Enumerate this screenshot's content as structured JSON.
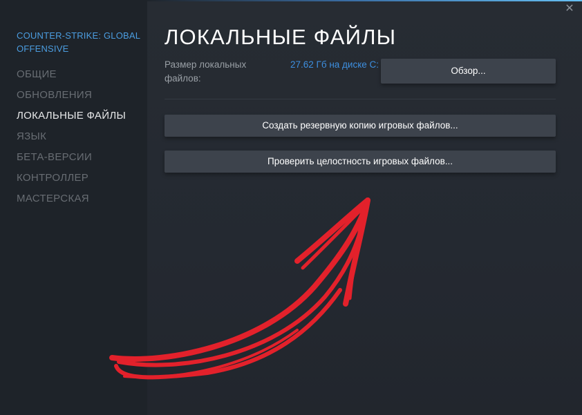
{
  "sidebar": {
    "game_title": "COUNTER-STRIKE: GLOBAL OFFENSIVE",
    "items": [
      {
        "label": "ОБЩИЕ"
      },
      {
        "label": "ОБНОВЛЕНИЯ"
      },
      {
        "label": "ЛОКАЛЬНЫЕ ФАЙЛЫ"
      },
      {
        "label": "ЯЗЫК"
      },
      {
        "label": "БЕТА-ВЕРСИИ"
      },
      {
        "label": "КОНТРОЛЛЕР"
      },
      {
        "label": "МАСТЕРСКАЯ"
      }
    ],
    "active_index": 2
  },
  "window": {
    "close_icon": "close-icon",
    "close_glyph": "✕"
  },
  "main": {
    "title": "ЛОКАЛЬНЫЕ ФАЙЛЫ",
    "size_label": "Размер локальных файлов:",
    "size_value": "27.62 Гб на диске C:",
    "browse_label": "Обзор...",
    "backup_label": "Создать резервную копию игровых файлов...",
    "verify_label": "Проверить целостность игровых файлов..."
  },
  "colors": {
    "background": "#1e2329",
    "accent_blue": "#4b9de0",
    "button": "#3d434c",
    "annotation_arrow": "#e3212b"
  }
}
